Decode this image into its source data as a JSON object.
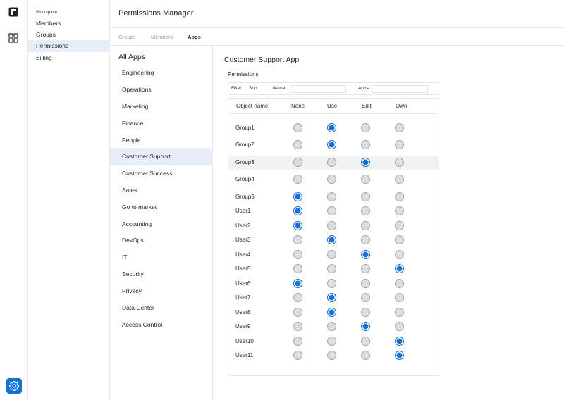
{
  "sidebar": {
    "workspace_label": "Workspace",
    "items": [
      {
        "label": "Members",
        "active": false
      },
      {
        "label": "Groups",
        "active": false
      },
      {
        "label": "Permissions",
        "active": true
      },
      {
        "label": "Billing",
        "active": false
      }
    ]
  },
  "rail": {
    "logo_icon": "app-logo-icon",
    "grid_icon": "apps-grid-icon",
    "settings_icon": "gear-icon",
    "accent": "#1670d6"
  },
  "header": {
    "title": "Permissions Manager"
  },
  "tabs": [
    {
      "label": "Groups",
      "active": false
    },
    {
      "label": "Members",
      "active": false
    },
    {
      "label": "Apps",
      "active": true
    }
  ],
  "apps": {
    "title": "All Apps",
    "items": [
      "Engineering",
      "Operations",
      "Marketing",
      "Finance",
      "People",
      "Customer Support",
      "Customer Success",
      "Sales",
      "Go to market",
      "Accounting",
      "DevOps",
      "IT",
      "Security",
      "Privacy",
      "Data Center",
      "Access Control"
    ],
    "selected": "Customer Support"
  },
  "detail": {
    "title": "Customer Support App",
    "permissions_label": "Permissions",
    "filter": {
      "filter_label": "Filter",
      "sort_label": "Sort",
      "name_label": "Name",
      "name_value": "",
      "apps_label": "Apps",
      "apps_value": ""
    },
    "columns": [
      "Object name",
      "None",
      "Use",
      "Edit",
      "Own"
    ],
    "rows": [
      {
        "name": "Group1",
        "level": "Use"
      },
      {
        "name": "Group2",
        "level": "Use"
      },
      {
        "name": "Group3",
        "level": "Edit"
      },
      {
        "name": "Group4",
        "level": ""
      },
      {
        "name": "Group5",
        "level": "None"
      },
      {
        "name": "User1",
        "level": "None"
      },
      {
        "name": "User2",
        "level": "None"
      },
      {
        "name": "User3",
        "level": "Use"
      },
      {
        "name": "User4",
        "level": "Edit"
      },
      {
        "name": "User5",
        "level": "Own"
      },
      {
        "name": "User6",
        "level": "None"
      },
      {
        "name": "User7",
        "level": "Use"
      },
      {
        "name": "User8",
        "level": "Use"
      },
      {
        "name": "User9",
        "level": "Edit"
      },
      {
        "name": "User10",
        "level": "Own"
      },
      {
        "name": "User11",
        "level": "Own"
      }
    ],
    "highlighted_row": "Group3"
  }
}
